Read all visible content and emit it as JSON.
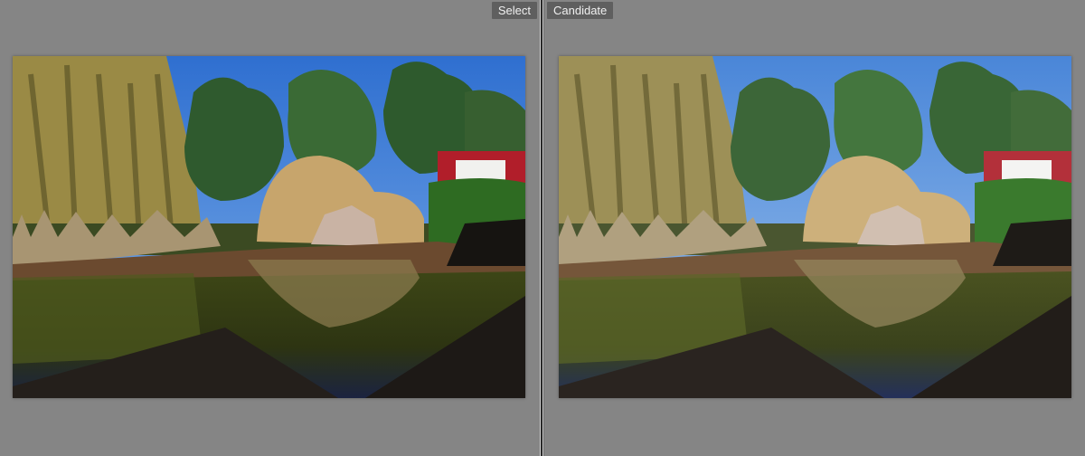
{
  "compare_view": {
    "select": {
      "label": "Select",
      "photo": {
        "description": "Garden pond with willow, pines, dry grass tufts, stone fountain, wooden deck and house",
        "tone": "select"
      }
    },
    "candidate": {
      "label": "Candidate",
      "photo": {
        "description": "Garden pond with willow, pines, dry grass tufts, stone fountain, wooden deck and house",
        "tone": "candidate"
      }
    }
  },
  "colors": {
    "sky_select": "#3f7fd8",
    "sky_candidate": "#5a93de",
    "pond_select": "#2f3714",
    "pond_candidate": "#3a421c",
    "deck": "#241f1b",
    "grass": "#c2a36e"
  }
}
